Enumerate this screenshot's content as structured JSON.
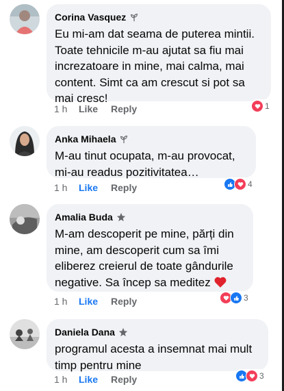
{
  "colors": {
    "bubble": "#f0f2f5",
    "text": "#050505",
    "meta": "#65676b",
    "like_blue": "#1877f2",
    "love_red": "#f33e58"
  },
  "comments": [
    {
      "author": "Corina Vasquez",
      "badge_icon": "rising-fan-icon",
      "text": "Eu mi-am dat seama de puterea mintii. Toate tehnicile m-au ajutat sa fiu mai increzatoare in mine, mai calma, mai content. Simt ca am crescut si pot sa mai cresc!",
      "time": "1 h",
      "like": "Like",
      "reply": "Reply",
      "reactions": [
        "love"
      ],
      "reaction_count": "1",
      "liked": false
    },
    {
      "author": "Anka Mihaela",
      "badge_icon": "rising-fan-icon",
      "text": "M-au tinut ocupata, m-au provocat, mi-au readus pozitivitatea…",
      "time": "1 h",
      "like": "Like",
      "reply": "Reply",
      "reactions": [
        "like",
        "love"
      ],
      "reaction_count": "4",
      "liked": true
    },
    {
      "author": "Amalia Buda",
      "badge_icon": "top-fan-star-icon",
      "text": "M-am descoperit pe mine, părți din mine, am descoperit cum sa îmi eliberez creierul de toate gândurile negative. Sa încep sa meditez",
      "trailing_emoji": "red-heart-icon",
      "time": "1 h",
      "like": "Like",
      "reply": "Reply",
      "reactions": [
        "love",
        "like"
      ],
      "reaction_count": "3",
      "liked": true
    },
    {
      "author": "Daniela Dana",
      "badge_icon": "top-fan-star-icon",
      "text": "programul acesta a insemnat mai mult timp pentru mine",
      "time": "1 h",
      "like": "Like",
      "reply": "Reply",
      "reactions": [
        "like",
        "love"
      ],
      "reaction_count": "3",
      "liked": true
    }
  ]
}
